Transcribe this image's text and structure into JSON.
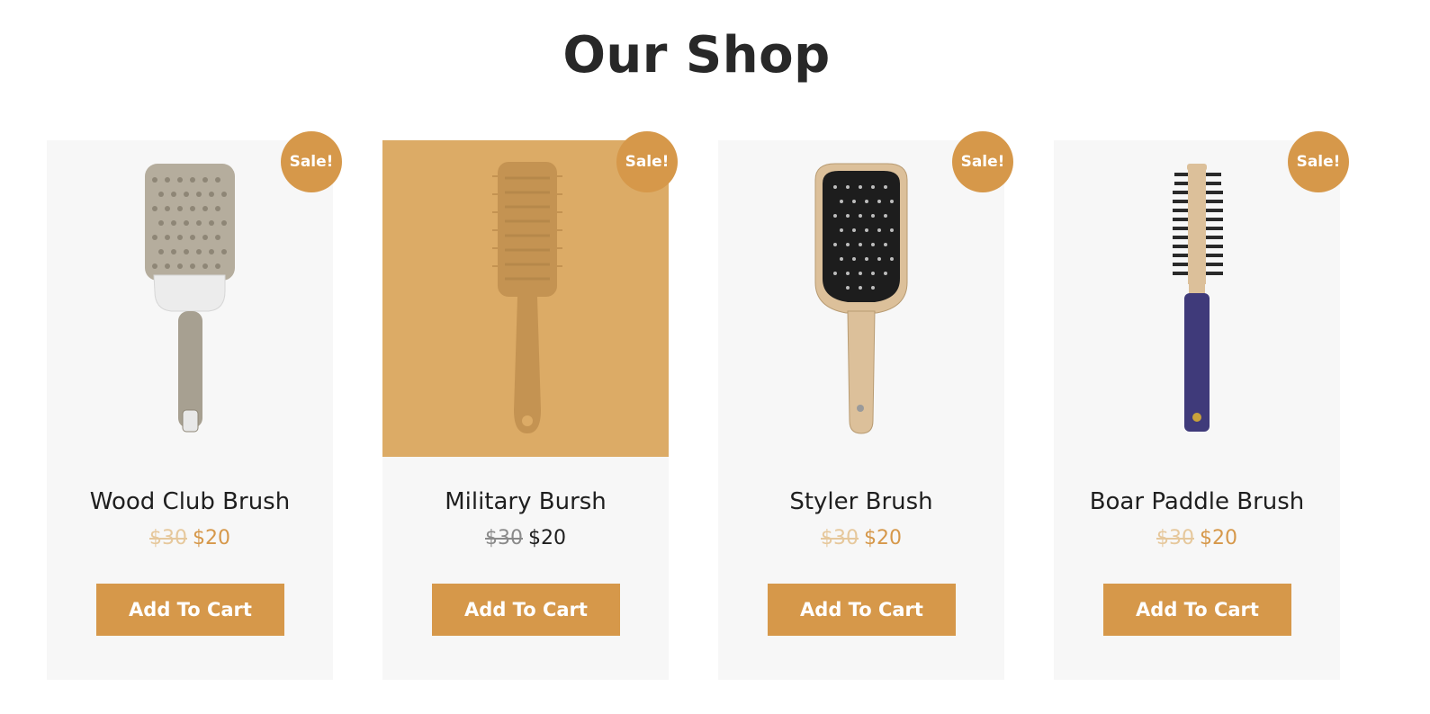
{
  "page": {
    "title": "Our Shop"
  },
  "products": [
    {
      "name": "Wood Club Brush",
      "badge": "Sale!",
      "old_price": "$30",
      "new_price": "$20",
      "button": "Add To Cart",
      "image_icon": "round-brush-icon"
    },
    {
      "name": "Military Bursh",
      "badge": "Sale!",
      "old_price": "$30",
      "new_price": "$20",
      "button": "Add To Cart",
      "image_icon": "vent-brush-icon",
      "hovered": true
    },
    {
      "name": "Styler Brush",
      "badge": "Sale!",
      "old_price": "$30",
      "new_price": "$20",
      "button": "Add To Cart",
      "image_icon": "paddle-brush-icon"
    },
    {
      "name": "Boar Paddle Brush",
      "badge": "Sale!",
      "old_price": "$30",
      "new_price": "$20",
      "button": "Add To Cart",
      "image_icon": "thin-round-brush-icon"
    }
  ],
  "colors": {
    "accent": "#d6984a",
    "hover_overlay": "#dcab66",
    "card_bg": "#f7f7f7"
  }
}
